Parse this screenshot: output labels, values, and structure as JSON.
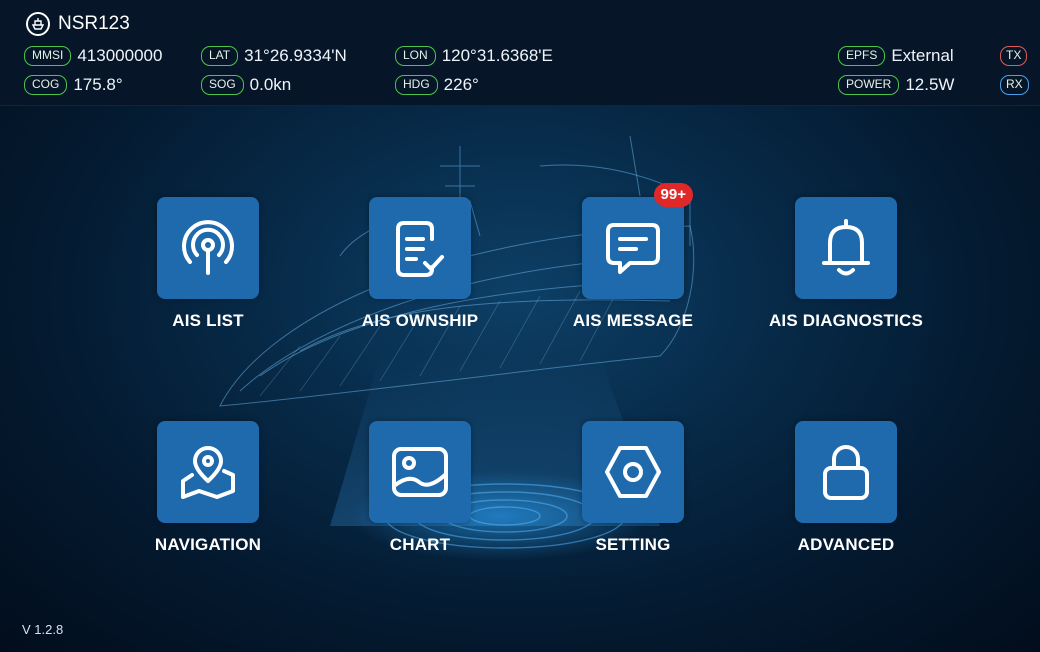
{
  "vessel": {
    "name": "NSR123",
    "icon": "ship-icon"
  },
  "status": {
    "mmsi": {
      "tag": "MMSI",
      "value": "413000000"
    },
    "lat": {
      "tag": "LAT",
      "value": "31°26.9334'N"
    },
    "lon": {
      "tag": "LON",
      "value": "120°31.6368'E"
    },
    "cog": {
      "tag": "COG",
      "value": "175.8°"
    },
    "sog": {
      "tag": "SOG",
      "value": "0.0kn"
    },
    "hdg": {
      "tag": "HDG",
      "value": "226°"
    },
    "epfs": {
      "tag": "EPFS",
      "value": "External"
    },
    "power": {
      "tag": "POWER",
      "value": "12.5W"
    },
    "tx": "TX",
    "rx": "RX"
  },
  "tiles": [
    {
      "label": "AIS LIST",
      "icon": "antenna-icon"
    },
    {
      "label": "AIS OWNSHIP",
      "icon": "document-check-icon"
    },
    {
      "label": "AIS MESSAGE",
      "icon": "message-icon",
      "badge": "99+"
    },
    {
      "label": "AIS DIAGNOSTICS",
      "icon": "bell-icon"
    },
    {
      "label": "NAVIGATION",
      "icon": "map-pin-icon"
    },
    {
      "label": "CHART",
      "icon": "image-icon"
    },
    {
      "label": "SETTING",
      "icon": "hexagon-settings-icon"
    },
    {
      "label": "ADVANCED",
      "icon": "lock-icon"
    }
  ],
  "version": "V 1.2.8",
  "colors": {
    "tile": "#1e6aad",
    "tag_green": "#4cc44a",
    "tx": "#e05a5a",
    "rx": "#4d9fe8",
    "badge": "#e02828"
  }
}
